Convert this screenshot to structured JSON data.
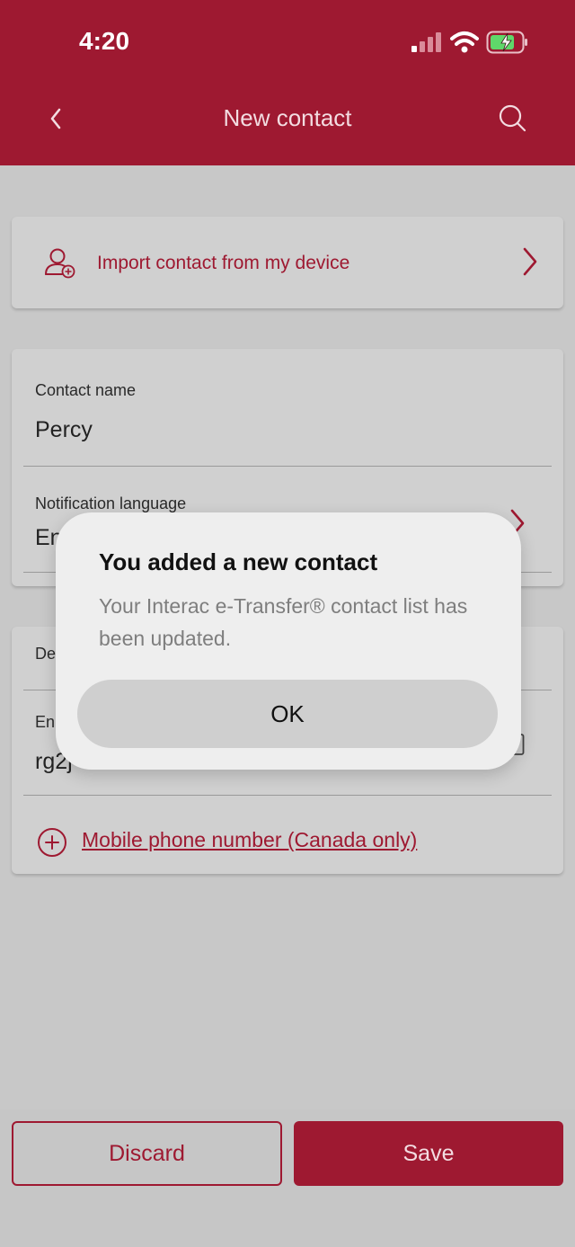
{
  "status_bar": {
    "time": "4:20"
  },
  "header": {
    "title": "New contact"
  },
  "import": {
    "label": "Import contact from my device"
  },
  "contact": {
    "name_label": "Contact name",
    "name_value": "Percy",
    "language_label": "Notification language",
    "language_value_partial": "En"
  },
  "delivery": {
    "section_label_partial": "De",
    "email_label_partial": "En",
    "email_value_partial": "rg2j",
    "add_phone_label": "Mobile phone number (Canada only)"
  },
  "footer": {
    "discard_label": "Discard",
    "save_label": "Save"
  },
  "dialog": {
    "title": "You added a new contact",
    "message": "Your Interac e-Transfer® contact list has been updated.",
    "ok_label": "OK"
  },
  "colors": {
    "brand": "#9e1931",
    "overlay": "#c8c8c8"
  }
}
